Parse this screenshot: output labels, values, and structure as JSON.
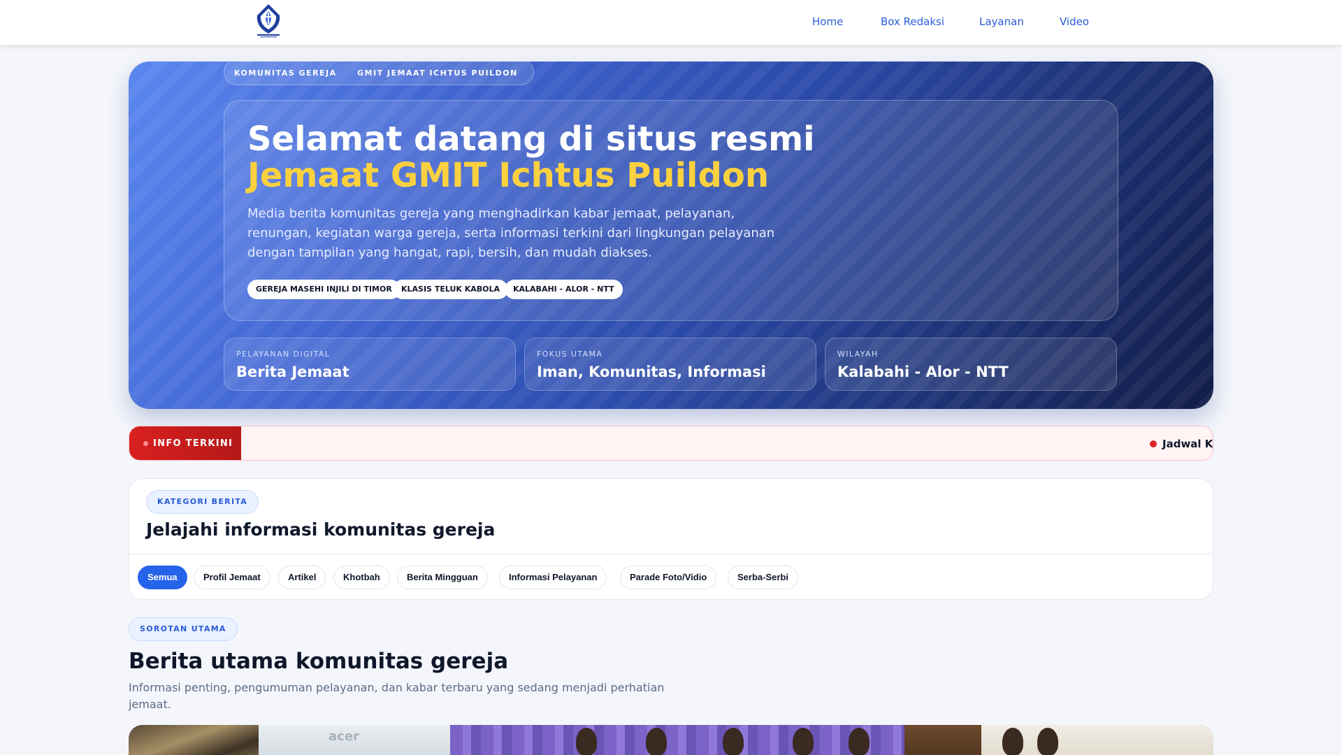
{
  "nav": {
    "logo_alt": "GMIT Jemaat Ichtus Puildon",
    "links": [
      "Home",
      "Box Redaksi",
      "Layanan",
      "Video"
    ]
  },
  "hero": {
    "chips": [
      "KOMUNITAS GEREJA",
      "GMIT JEMAAT ICHTUS PUILDON"
    ],
    "title_line1": "Selamat datang di situs resmi",
    "title_line2": "Jemaat GMIT Ichtus Puildon",
    "description": "Media berita komunitas gereja yang menghadirkan kabar jemaat, pelayanan, renungan, kegiatan warga gereja, serta informasi terkini dari lingkungan pelayanan dengan tampilan yang hangat, rapi, bersih, dan mudah diakses.",
    "pills": [
      "GEREJA MASEHI INJILI DI TIMOR",
      "KLASIS TELUK KABOLA",
      "KALABAHI - ALOR - NTT"
    ],
    "stats": [
      {
        "label": "PELAYANAN DIGITAL",
        "value": "Berita Jemaat"
      },
      {
        "label": "FOKUS UTAMA",
        "value": "Iman, Komunitas, Informasi"
      },
      {
        "label": "WILAYAH",
        "value": "Kalabahi - Alor - NTT"
      }
    ]
  },
  "ticker": {
    "label": "INFO TERKINI",
    "item": "Jadwal Ke"
  },
  "category": {
    "badge": "KATEGORI BERITA",
    "title": "Jelajahi informasi komunitas gereja",
    "tabs": [
      "Semua",
      "Profil Jemaat",
      "Artikel",
      "Khotbah",
      "Berita Mingguan",
      "Informasi Pelayanan",
      "Parade Foto/Vidio",
      "Serba-Serbi"
    ],
    "active_tab": "Semua"
  },
  "sorotan": {
    "badge": "SOROTAN UTAMA",
    "title": "Berita utama komunitas gereja",
    "description": "Informasi penting, pengumuman pelayanan, dan kabar terbaru yang sedang menjadi perhatian jemaat."
  },
  "featured_photo": {
    "screen_text": "acer"
  },
  "colors": {
    "brand_blue": "#2a5bd7",
    "accent_yellow": "#fbd140",
    "ticker_red": "#d92020",
    "active_tab": "#2563eb"
  }
}
